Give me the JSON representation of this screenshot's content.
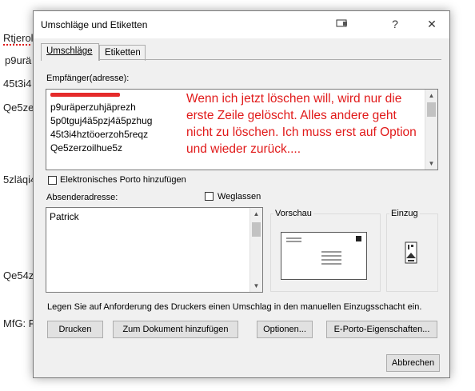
{
  "document": {
    "lines": [
      "Rtjerol",
      "p9urä",
      "45t3i4",
      "Qe5ze",
      "5zläqi4",
      "Qe54z",
      "MfG: F"
    ]
  },
  "dialog": {
    "title": "Umschläge und Etiketten",
    "help_label": "?",
    "close_label": "✕",
    "tabs": [
      {
        "label": "Umschläge",
        "active": true
      },
      {
        "label": "Etiketten",
        "active": false
      }
    ],
    "recipient_label": "Empfänger(adresse):",
    "recipient_lines": [
      "p9uräperzuhjäprezh",
      "5p0tguj4ä5pzj4ä5pzhug",
      "45t3i4hztöoerzoh5reqz",
      "Qe5zerzoilhue5z"
    ],
    "annotation": "Wenn ich jetzt löschen will, wird nur die erste Zeile gelöscht. Alles andere geht nicht zu löschen. Ich muss erst auf Option und wieder zurück....",
    "eporto_checkbox_label": "Elektronisches Porto hinzufügen",
    "sender_label": "Absenderadresse:",
    "omit_label": "Weglassen",
    "sender_value": "Patrick",
    "preview_label": "Vorschau",
    "feed_label": "Einzug",
    "info_text": "Legen Sie auf Anforderung des Druckers einen Umschlag in den manuellen Einzugsschacht ein.",
    "buttons": {
      "print": "Drucken",
      "add_to_doc": "Zum Dokument hinzufügen",
      "options": "Optionen...",
      "eporto_props": "E-Porto-Eigenschaften...",
      "cancel": "Abbrechen"
    }
  }
}
